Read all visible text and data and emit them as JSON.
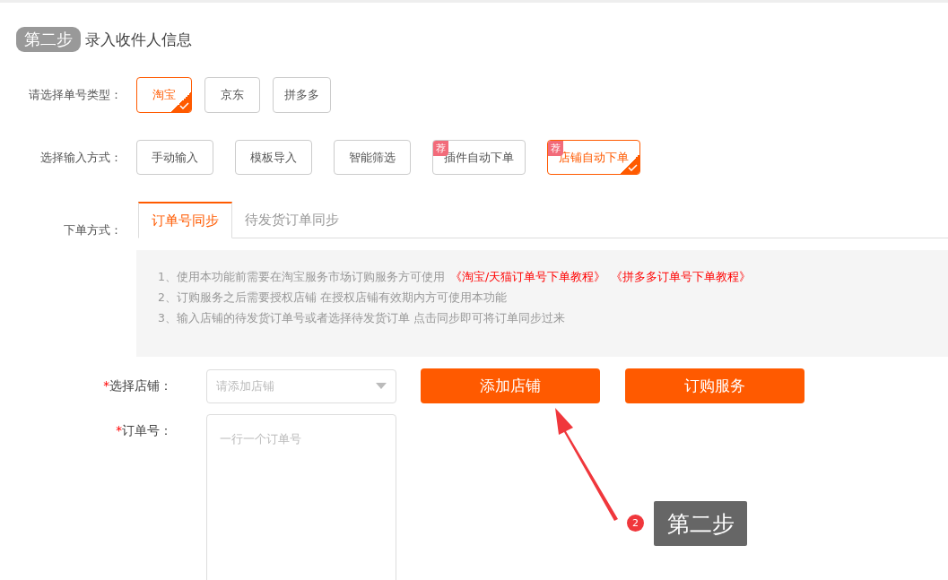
{
  "step": {
    "badge": "第二步",
    "title": "录入收件人信息"
  },
  "order_type": {
    "label": "请选择单号类型：",
    "options": [
      {
        "label": "淘宝",
        "selected": true
      },
      {
        "label": "京东",
        "selected": false
      },
      {
        "label": "拼多多",
        "selected": false
      }
    ]
  },
  "input_method": {
    "label": "选择输入方式：",
    "options": [
      {
        "label": "手动输入",
        "selected": false
      },
      {
        "label": "模板导入",
        "selected": false
      },
      {
        "label": "智能筛选",
        "selected": false
      },
      {
        "label": "插件自动下单",
        "selected": false,
        "badge": "荐"
      },
      {
        "label": "店铺自动下单",
        "selected": true,
        "badge": "荐"
      }
    ]
  },
  "order_mode": {
    "label": "下单方式：",
    "tabs": [
      {
        "label": "订单号同步",
        "selected": true
      },
      {
        "label": "待发货订单同步",
        "selected": false
      }
    ]
  },
  "notice": [
    {
      "text": "1、使用本功能前需要在淘宝服务市场订购服务方可使用",
      "links": [
        "《淘宝/天猫订单号下单教程》",
        "《拼多多订单号下单教程》"
      ]
    },
    {
      "text": "2、订购服务之后需要授权店铺 在授权店铺有效期内方可使用本功能"
    },
    {
      "text": "3、输入店铺的待发货订单号或者选择待发货订单 点击同步即可将订单同步过来"
    }
  ],
  "store": {
    "marker": "*",
    "label": "选择店铺：",
    "placeholder": "请添加店铺"
  },
  "buttons": [
    "添加店铺",
    "订购服务"
  ],
  "order_no": {
    "marker": "*",
    "label": "订单号：",
    "placeholder": "一行一个订单号"
  },
  "annotation": {
    "number": "2",
    "text": "第二步"
  }
}
